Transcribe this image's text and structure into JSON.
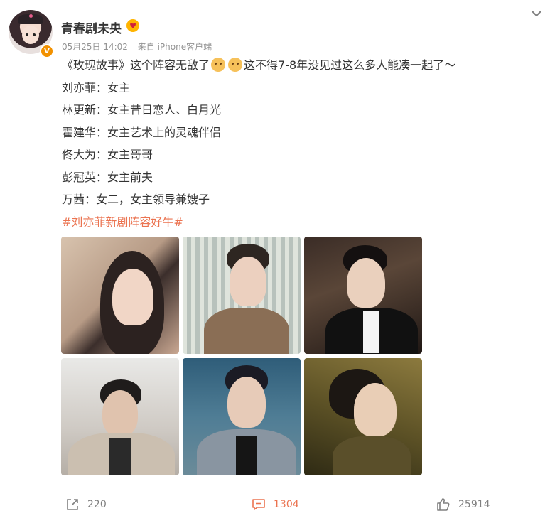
{
  "post": {
    "username": "青春剧未央",
    "date": "05月25日 14:02",
    "source": "来自 iPhone客户端",
    "lines": [
      {
        "pre": "《玫瑰故事》这个阵容无敌了",
        "post": "这不得7-8年没见过这么多人能凑一起了～"
      },
      {
        "text": "刘亦菲：女主"
      },
      {
        "text": "林更新：女主昔日恋人、白月光"
      },
      {
        "text": "霍建华：女主艺术上的灵魂伴侣"
      },
      {
        "text": "佟大为：女主哥哥"
      },
      {
        "text": "彭冠英：女主前夫"
      },
      {
        "text": "万茜：女二，女主领导兼嫂子"
      }
    ],
    "topic": "#刘亦菲新剧阵容好牛#"
  },
  "actions": {
    "repost_count": "220",
    "comment_count": "1304",
    "like_count": "25914"
  },
  "colors": {
    "accent": "#eb7350",
    "meta_gray": "#939393",
    "verified": "#f29100"
  },
  "icons": [
    "chevron-down-icon",
    "repost-icon",
    "comment-icon",
    "like-icon",
    "verified-icon",
    "user-badge-icon"
  ]
}
